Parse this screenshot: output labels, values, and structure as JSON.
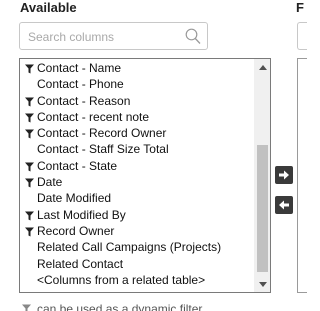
{
  "available_heading": "Available",
  "right_heading_partial": "F",
  "search": {
    "placeholder": "Search columns",
    "value": ""
  },
  "columns": [
    {
      "label": "Contact - Name",
      "filterable": true
    },
    {
      "label": "Contact - Phone",
      "filterable": false
    },
    {
      "label": "Contact - Reason",
      "filterable": true
    },
    {
      "label": "Contact - recent note",
      "filterable": true
    },
    {
      "label": "Contact - Record Owner",
      "filterable": true
    },
    {
      "label": "Contact - Staff Size Total",
      "filterable": false
    },
    {
      "label": "Contact - State",
      "filterable": true
    },
    {
      "label": "Date",
      "filterable": true
    },
    {
      "label": "Date Modified",
      "filterable": false
    },
    {
      "label": "Last Modified By",
      "filterable": true
    },
    {
      "label": "Record Owner",
      "filterable": true
    },
    {
      "label": "Related Call Campaigns (Projects)",
      "filterable": false
    },
    {
      "label": "Related Contact",
      "filterable": false
    },
    {
      "label": "<Columns from a related table>",
      "filterable": false
    }
  ],
  "icons": {
    "filter": "filter-funnel-icon",
    "search": "magnifier-icon",
    "add": "arrow-right-icon",
    "remove": "arrow-left-icon"
  },
  "legend_text": "can be used as a dynamic filter",
  "colors": {
    "button_bg": "#3a3a3a",
    "scroll_thumb": "#c1c1c1",
    "border": "#7a7a7a"
  }
}
